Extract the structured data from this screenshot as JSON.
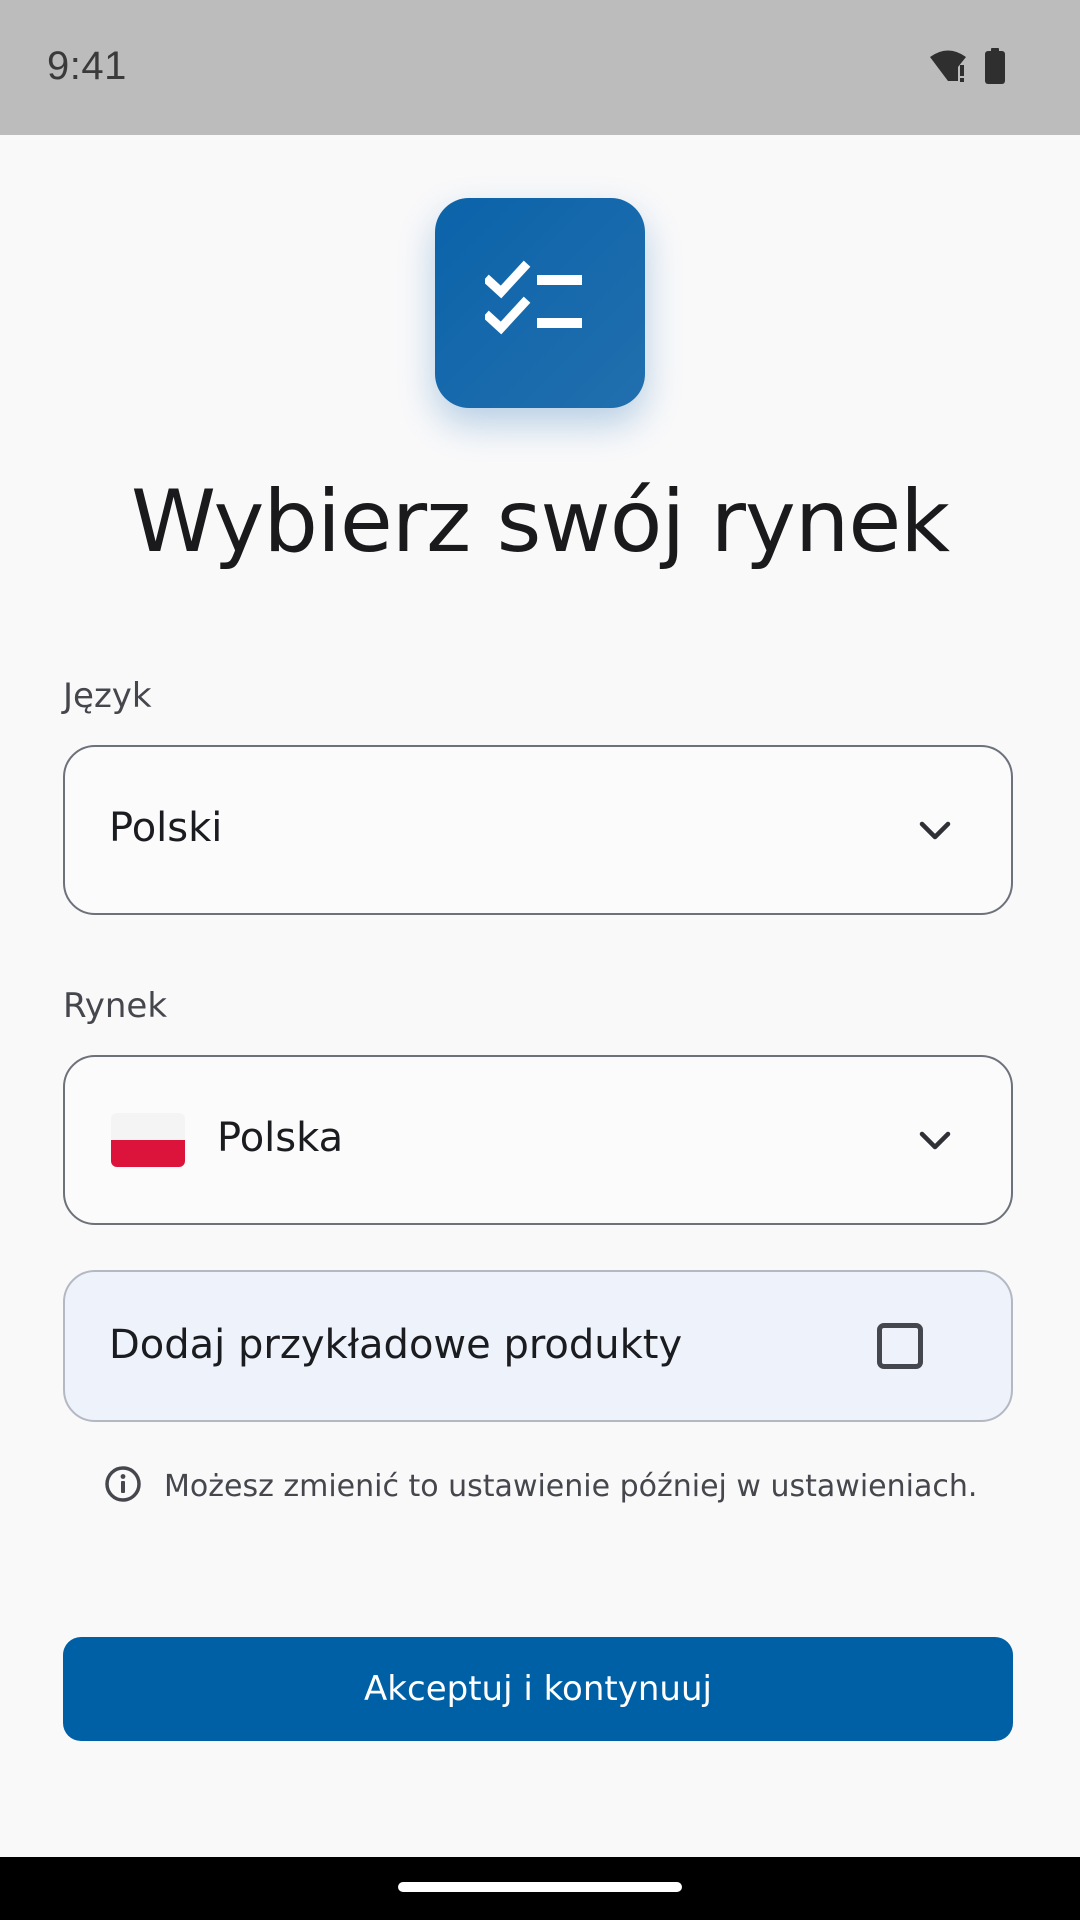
{
  "status_bar": {
    "time": "9:41",
    "icons": [
      "wifi-alert-icon",
      "battery-icon"
    ]
  },
  "app": {
    "icon": "checklist-icon",
    "brand_color": "#0060a5"
  },
  "title": "Wybierz swój rynek",
  "language": {
    "label": "Język",
    "value": "Polski",
    "icon": "chevron-down-icon"
  },
  "market": {
    "label": "Rynek",
    "value": "Polska",
    "flag": "poland-flag-icon",
    "icon": "chevron-down-icon"
  },
  "sample_products": {
    "label": "Dodaj przykładowe produkty",
    "checked": false
  },
  "info": {
    "icon": "info-icon",
    "text": "Możesz zmienić to ustawienie później w ustawieniach."
  },
  "primary_button": {
    "label": "Akceptuj i kontynuuj"
  }
}
